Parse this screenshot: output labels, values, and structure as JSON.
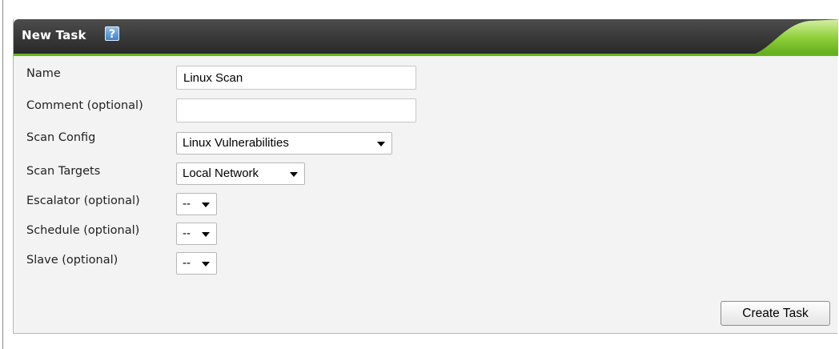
{
  "panel": {
    "title": "New Task",
    "help_icon_glyph": "?",
    "help_icon": "help-icon",
    "accent_color": "#67b31d",
    "header_color": "#333333"
  },
  "form": {
    "name": {
      "label": "Name",
      "value": "Linux Scan"
    },
    "comment": {
      "label": "Comment (optional)",
      "value": ""
    },
    "scan_config": {
      "label": "Scan Config",
      "selected": "Linux Vulnerabilities"
    },
    "scan_targets": {
      "label": "Scan Targets",
      "selected": "Local Network"
    },
    "escalator": {
      "label": "Escalator (optional)",
      "selected": "--"
    },
    "schedule": {
      "label": "Schedule (optional)",
      "selected": "--"
    },
    "slave": {
      "label": "Slave (optional)",
      "selected": "--"
    }
  },
  "actions": {
    "create_label": "Create Task"
  }
}
